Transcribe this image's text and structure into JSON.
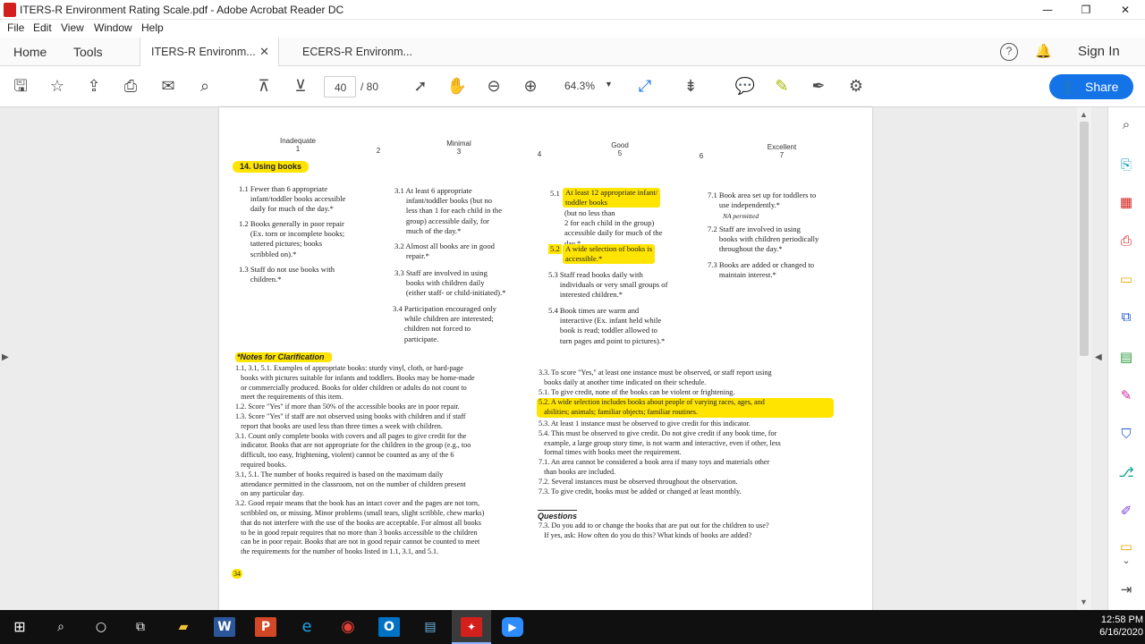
{
  "window": {
    "title": "ITERS-R Environment Rating Scale.pdf - Adobe Acrobat Reader DC",
    "minimize": "—",
    "restore": "❐",
    "close": "✕"
  },
  "menu": [
    "File",
    "Edit",
    "View",
    "Window",
    "Help"
  ],
  "tabs": {
    "home": "Home",
    "tools": "Tools",
    "doc1": "ITERS-R Environm...",
    "doc1_close": "✕",
    "doc2": "ECERS-R Environm...",
    "help": "?",
    "signin": "Sign In"
  },
  "toolbar": {
    "current_page": "40",
    "total_pages": "/ 80",
    "zoom": "64.3%",
    "share": "Share"
  },
  "document": {
    "scale": {
      "inadequate": "Inadequate",
      "l1": "1",
      "l2": "2",
      "minimal": "Minimal",
      "l3": "3",
      "l4": "4",
      "good": "Good",
      "l5": "5",
      "l6": "6",
      "excellent": "Excellent",
      "l7": "7"
    },
    "item_title": "14. Using books",
    "col1": {
      "i1_1": "1.1 Fewer than 6 appropriate\n      infant/toddler books accessible\n      daily for much of the day.*",
      "i1_2": "1.2 Books generally in poor repair\n      (Ex. torn or incomplete books;\n      tattered pictures; books\n      scribbled on).*",
      "i1_3": "1.3 Staff do not use books with\n      children.*"
    },
    "col3": {
      "i3_1": "3.1 At least 6 appropriate\n      infant/toddler books (but no\n      less than 1 for each child in the\n      group) accessible daily, for\n      much of the day.*",
      "i3_2": "3.2 Almost all books are in good\n      repair.*",
      "i3_3": "3.3 Staff are involved in using\n      books with children daily\n      (either staff- or child-initiated).*",
      "i3_4": "3.4 Participation encouraged only\n      while children are interested;\n      children not forced to\n      participate."
    },
    "col5": {
      "i5_1_hl": "At least 12 appropriate infant/\ntoddler books",
      "i5_1": "5.1",
      "i5_1_rest": "(but no less than\n2 for each child in the group)\naccessible daily for much of the\nday.*",
      "i5_2_num": "5.2",
      "i5_2_hl": "A wide selection of books is\naccessible.*",
      "i5_3": "5.3 Staff read books daily with\n      individuals or very small groups of\n      interested children.*",
      "i5_4": "5.4 Book times are warm and\n      interactive (Ex. infant held while\n      book is read; toddler allowed to\n      turn pages and point to pictures).*"
    },
    "col7": {
      "i7_1": "7.1 Book area set up for toddlers to\n      use independently.*",
      "i7_1_na": "NA permitted",
      "i7_2": "7.2 Staff are involved in using\n      books with children periodically\n      throughout the day.*",
      "i7_3": "7.3 Books are added or changed to\n      maintain interest.*"
    },
    "notes_title": "*Notes for Clarification",
    "notes_left": "1.1, 3.1, 5.1. Examples of appropriate books: sturdy vinyl, cloth, or hard-page\n   books with pictures suitable for infants and toddlers. Books may be home-made\n   or commercially produced. Books for older children or adults do not count to\n   meet the requirements of this item.\n1.2. Score \"Yes\" if more than 50% of the accessible books are in poor repair.\n1.3. Score \"Yes\" if staff are not observed using books with children and if staff\n   report that books are used less than three times a week with children.\n3.1. Count only complete books with covers and all pages to give credit for the\n   indicator. Books that are not appropriate for the children in the group (e.g., too\n   difficult, too easy, frightening, violent) cannot be counted as any of the 6\n   required books.\n3.1, 5.1. The number of books required is based on the maximum daily\n   attendance permitted in the classroom, not on the number of children present\n   on any particular day.\n3.2. Good repair means that the book has an intact cover and the pages are not torn,\n   scribbled on, or missing. Minor problems (small tears, slight scribble, chew marks)\n   that do not interfere with the use of the books are acceptable. For almost all books\n   to be in good repair requires that no more than 3 books accessible to the children\n   can be in poor repair. Books that are not in good repair cannot be counted to meet\n   the requirements for the number of books listed in 1.1, 3.1, and 5.1.",
    "notes_right_1": "3.3. To score \"Yes,\" at least one instance must be observed, or staff report using\n   books daily at another time indicated on their schedule.\n5.1. To give credit, none of the books can be violent or frightening.",
    "notes_right_hl": "5.2. A wide selection includes books about people of varying races, ages, and\n   abilities; animals; familiar objects; familiar routines.",
    "notes_right_2": "5.3. At least 1 instance must be observed to give credit for this indicator.\n5.4. This must be observed to give credit. Do not give credit if any book time, for\n   example, a large group story time, is not warm and interactive, even if other, less\n   formal times with books meet the requirement.\n7.1. An area cannot be considered a book area if many toys and materials other\n   than books are included.\n7.2. Several instances must be observed throughout the observation.\n7.3. To give credit, books must be added or changed at least monthly.",
    "questions_title": "Questions",
    "questions": "7.3. Do you add to or change the books that are put out for the children to use?\n   If yes, ask: How often do you do this? What kinds of books are added?",
    "page_number": "34"
  },
  "taskbar": {
    "time": "12:58 PM",
    "date": "6/16/2020"
  },
  "colors": {
    "accent": "#1473e6",
    "highlight": "#ffe400",
    "acrobat_red": "#d4201d"
  }
}
